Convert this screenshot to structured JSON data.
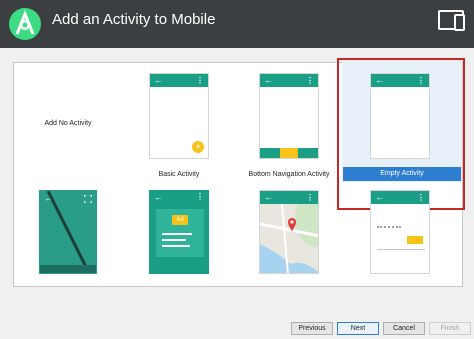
{
  "header": {
    "title": "Add an Activity to Mobile"
  },
  "gallery": {
    "items": [
      {
        "label": "Add No Activity"
      },
      {
        "label": "Basic Activity"
      },
      {
        "label": "Bottom Navigation Activity"
      },
      {
        "label": "Empty Activity",
        "selected": true
      },
      {
        "label": ""
      },
      {
        "label": ""
      },
      {
        "label": ""
      },
      {
        "label": ""
      }
    ],
    "ad_badge": "Ad",
    "appbar_back_glyph": "←",
    "appbar_menu_glyph": "⋮"
  },
  "footer": {
    "previous": "Previous",
    "next": "Next",
    "cancel": "Cancel",
    "finish": "Finish"
  },
  "colors": {
    "header": "#3c3f41",
    "teal": "#1b9e86",
    "selection_border": "#c62828",
    "selection_label": "#2e7fd1",
    "accent_yellow": "#f9c21a"
  }
}
